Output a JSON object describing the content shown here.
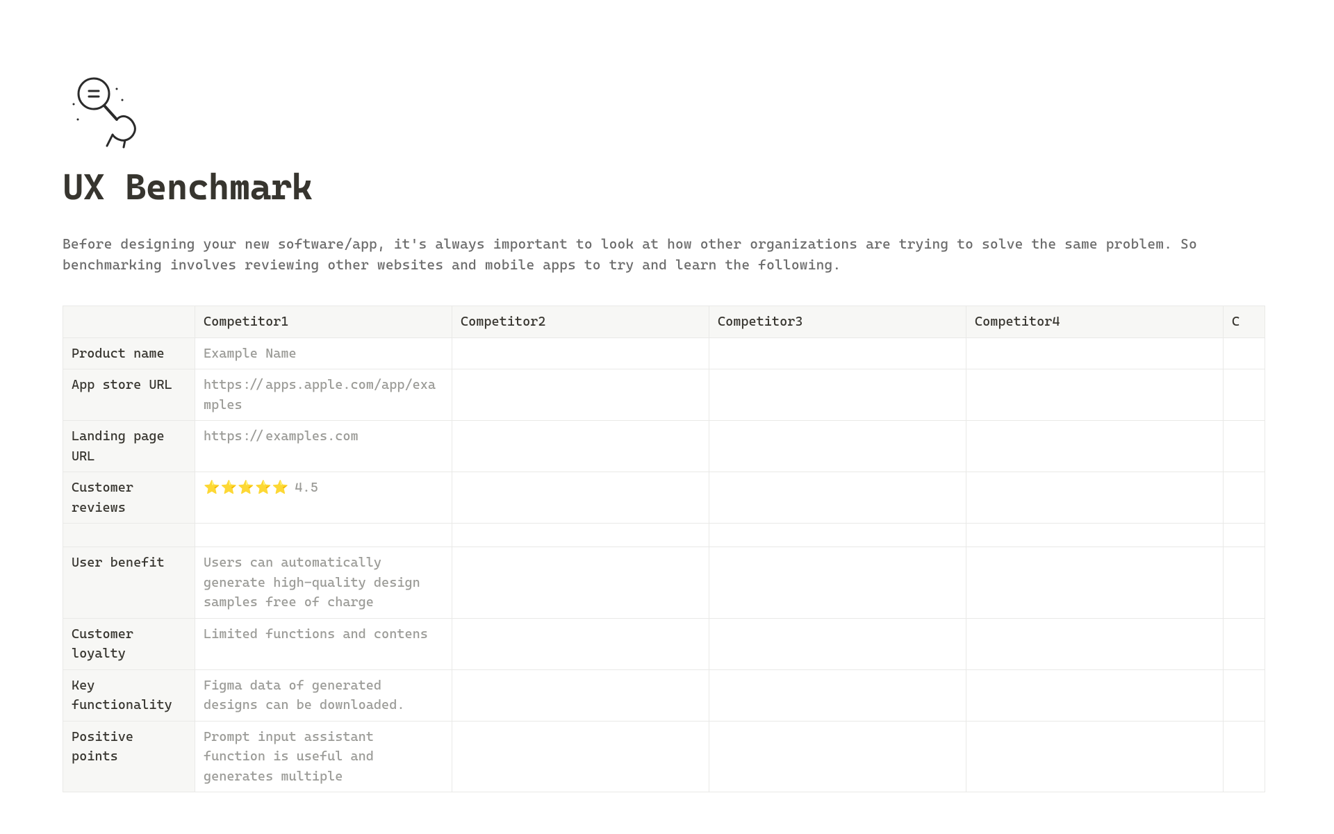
{
  "page": {
    "title": "UX Benchmark",
    "intro": "Before designing your new software/app, it's always important to look at how other organizations are trying to solve the same problem. So benchmarking involves reviewing other websites and mobile apps to try and learn the following."
  },
  "table": {
    "columns": [
      "Competitor1",
      "Competitor2",
      "Competitor3",
      "Competitor4",
      "C"
    ],
    "rows": [
      {
        "label": "Product name",
        "c1": "Example Name",
        "c2": "",
        "c3": "",
        "c4": "",
        "c5": ""
      },
      {
        "label": "App store URL",
        "c1": "https://apps.apple.com/app/examples",
        "c2": "",
        "c3": "",
        "c4": "",
        "c5": ""
      },
      {
        "label": "Landing page URL",
        "c1": "https://examples.com",
        "c2": "",
        "c3": "",
        "c4": "",
        "c5": ""
      },
      {
        "label": "Customer reviews",
        "c1_stars": "⭐⭐⭐⭐⭐",
        "c1_rating": "4.5",
        "c2": "",
        "c3": "",
        "c4": "",
        "c5": ""
      },
      {
        "label": "",
        "c1": "",
        "c2": "",
        "c3": "",
        "c4": "",
        "c5": ""
      },
      {
        "label": "User benefit",
        "c1": "Users can automatically generate high-quality design samples free of charge",
        "c2": "",
        "c3": "",
        "c4": "",
        "c5": ""
      },
      {
        "label": "Customer loyalty",
        "c1": "Limited functions and contens",
        "c2": "",
        "c3": "",
        "c4": "",
        "c5": ""
      },
      {
        "label": "Key functionality",
        "c1": "Figma data of generated designs can be downloaded.",
        "c2": "",
        "c3": "",
        "c4": "",
        "c5": ""
      },
      {
        "label": "Positive points",
        "c1": "Prompt input assistant function is useful and generates multiple",
        "c2": "",
        "c3": "",
        "c4": "",
        "c5": ""
      }
    ]
  }
}
